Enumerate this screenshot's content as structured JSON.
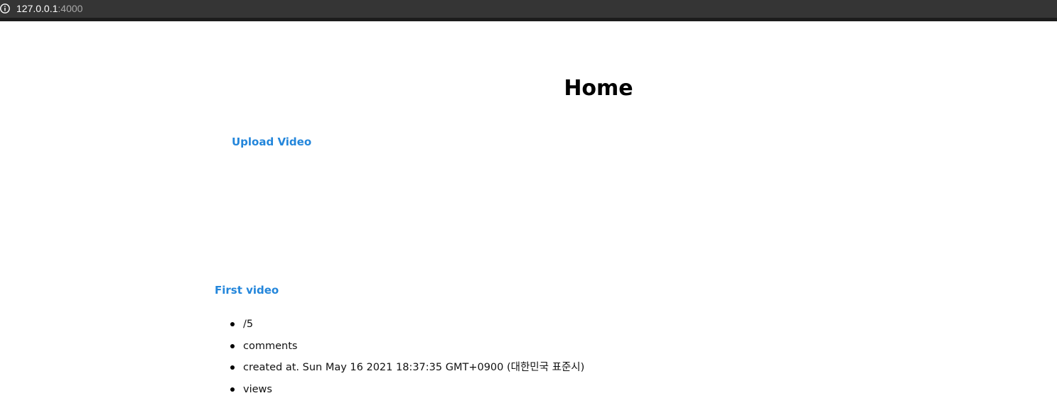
{
  "browser": {
    "url_host": "127.0.0.1",
    "url_port": ":4000",
    "info_icon": "info-icon"
  },
  "page": {
    "title": "Home",
    "upload_link": "Upload Video"
  },
  "videos": [
    {
      "title": "First video",
      "rating": "/5",
      "comments": "comments",
      "created": "created at. Sun May 16 2021 18:37:35 GMT+0900 (대한민국 표준시)",
      "views": "views"
    }
  ]
}
